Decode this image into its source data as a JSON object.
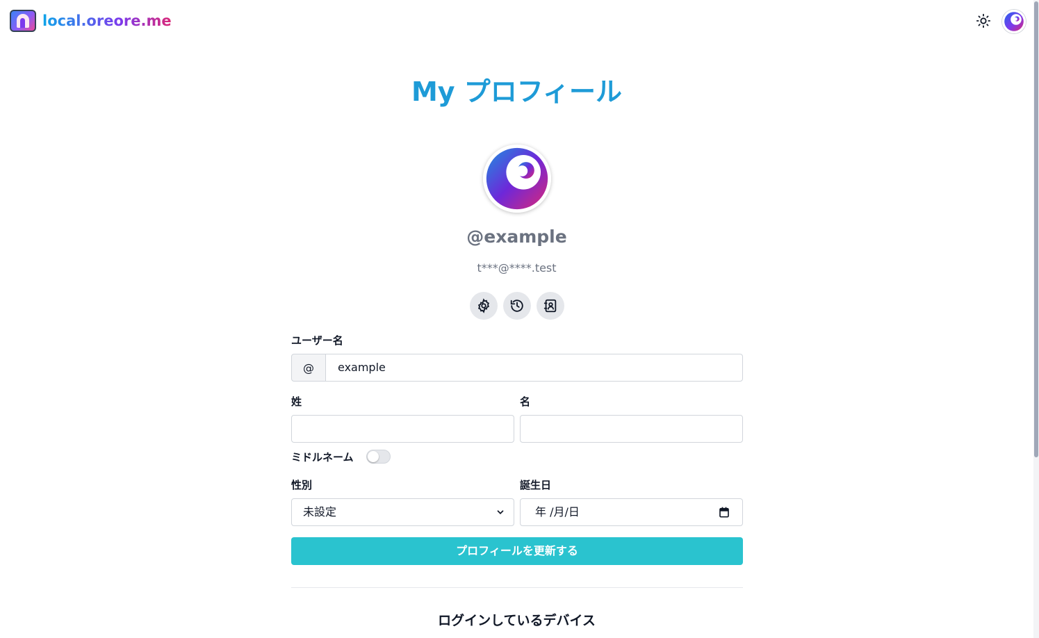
{
  "header": {
    "site_name": "local.oreore.me",
    "logo_icon": "keyhole-logo-icon",
    "theme_icon": "sun-icon",
    "avatar_icon": "swirl-avatar-icon"
  },
  "page": {
    "title": "My プロフィール"
  },
  "profile": {
    "handle": "@example",
    "masked_email": "t***@****.test",
    "action_icons": [
      "gear-icon",
      "history-icon",
      "contacts-icon"
    ]
  },
  "form": {
    "username_label": "ユーザー名",
    "username_prefix": "@",
    "username_value": "example",
    "last_name_label": "姓",
    "last_name_value": "",
    "first_name_label": "名",
    "first_name_value": "",
    "middle_name_label": "ミドルネーム",
    "middle_name_enabled": false,
    "gender_label": "性別",
    "gender_value": "未設定",
    "birthday_label": "誕生日",
    "birthday_placeholder": "年 /月/日",
    "submit_label": "プロフィールを更新する"
  },
  "devices": {
    "section_title": "ログインしているデバイス"
  },
  "colors": {
    "title": "#1e9bd7",
    "submit": "#2ac3cf",
    "handle": "#6b7280"
  }
}
